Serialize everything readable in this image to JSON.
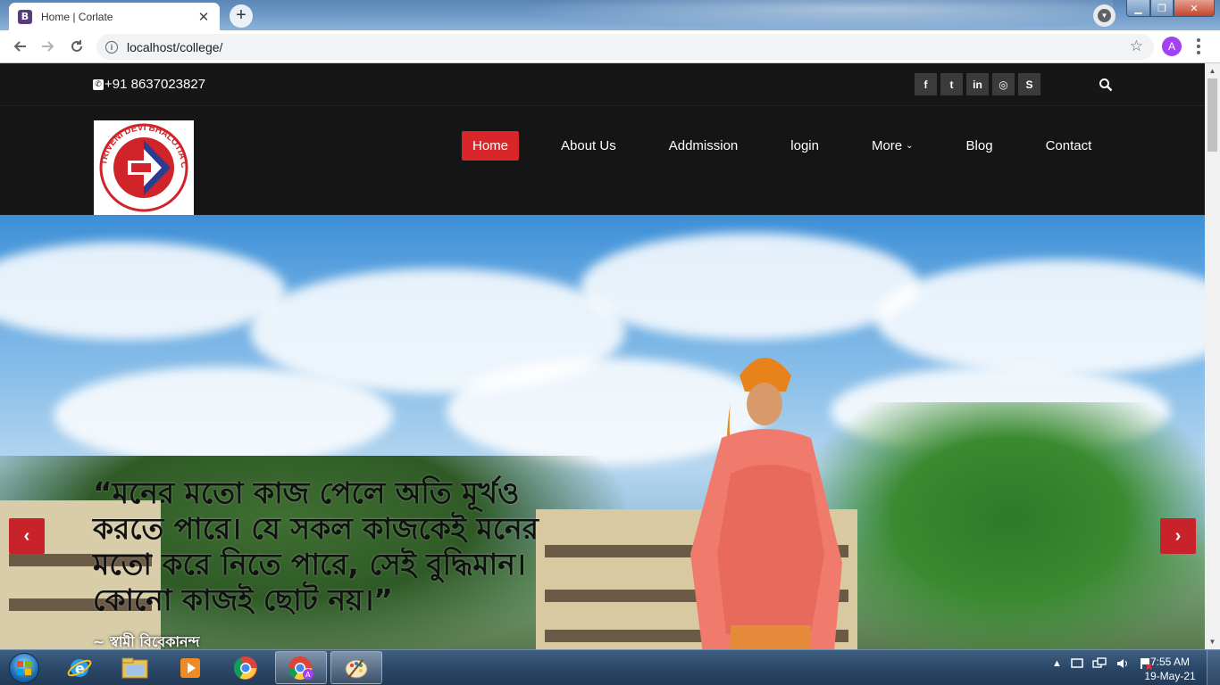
{
  "browser": {
    "tab_title": "Home | Corlate",
    "tab_favicon_letter": "B",
    "new_tab_symbol": "+",
    "url": "localhost/college/",
    "profile_letter": "A"
  },
  "site": {
    "phone": "+91 8637023827",
    "social_icons": [
      "facebook-icon",
      "twitter-icon",
      "linkedin-icon",
      "dribbble-icon",
      "skype-icon"
    ],
    "social_glyphs": [
      "f",
      "t",
      "in",
      "◎",
      "S"
    ],
    "logo_text": "TRIVENI DEVI BHALOTIA COLLEGE",
    "nav": {
      "home": "Home",
      "about": "About Us",
      "admission": "Addmission",
      "login": "login",
      "more": "More",
      "blog": "Blog",
      "contact": "Contact"
    },
    "hero": {
      "quote": "“মনের মতো কাজ পেলে অতি মূর্খও করতে পারে। যে সকল কাজকেই মনের মতো করে নিতে পারে, সেই বুদ্ধিমান। কোনো কাজই ছোট নয়।”",
      "author": "~ স্বামী বিবেকানন্দ",
      "prev_symbol": "‹",
      "next_symbol": "›"
    },
    "colors": {
      "accent": "#d8262a",
      "topbar": "#161616",
      "navbar": "#151515"
    }
  },
  "taskbar": {
    "time": "7:55 AM",
    "date": "19-May-21",
    "tray_arrow": "▲"
  }
}
